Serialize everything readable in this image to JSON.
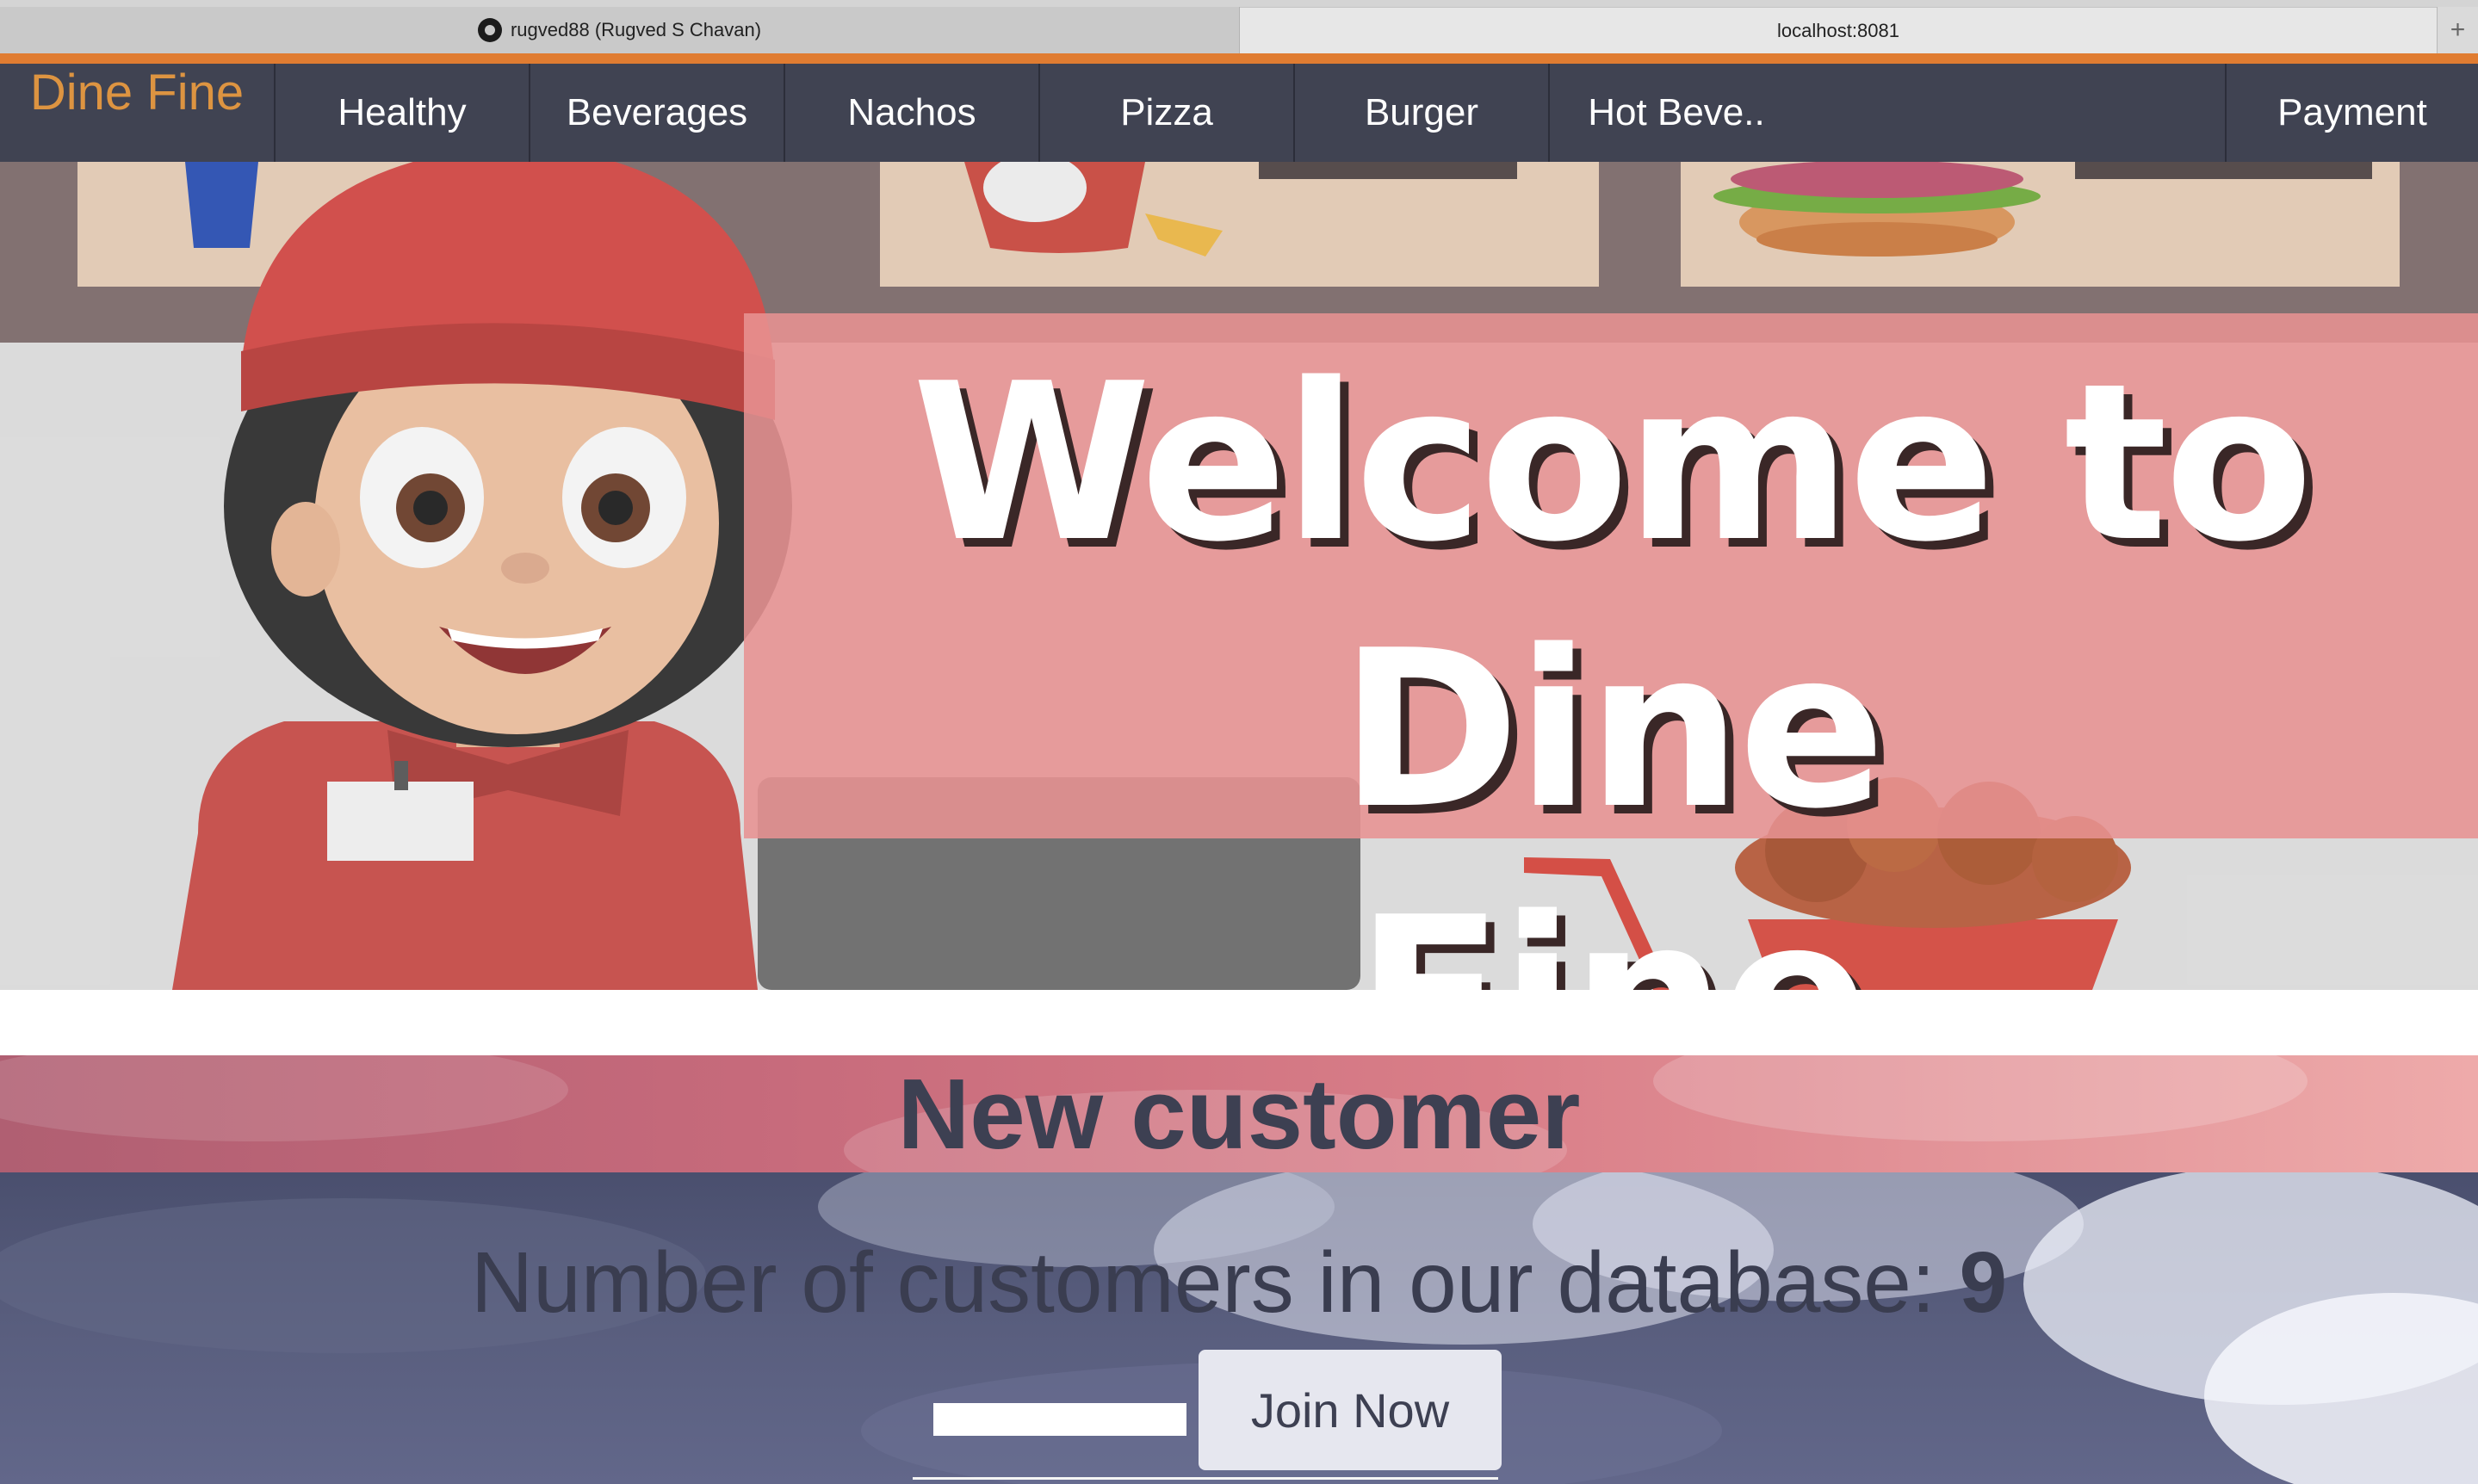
{
  "browser": {
    "tabs": [
      {
        "label": "rugved88 (Rugved S Chavan)",
        "icon": "github-icon"
      },
      {
        "label": "localhost:8081"
      }
    ],
    "new_tab_label": "+"
  },
  "navbar": {
    "brand": "Dine Fine",
    "items": [
      "Healthy",
      "Beverages",
      "Nachos",
      "Pizza",
      "Burger",
      "Hot Beve..",
      "Payment"
    ]
  },
  "hero": {
    "title_line1": "Welcome to Dine",
    "title_line2": "Fine Restaurant"
  },
  "new_customer": {
    "heading": "New customer",
    "count_label": "Number of customers in our database: ",
    "count_value": "9",
    "input_value": "",
    "join_button": "Join Now"
  },
  "colors": {
    "accent_orange": "#e07c31",
    "brand_text": "#dd9441",
    "navbar_bg": "#404352",
    "hero_overlay": "#e79292"
  }
}
